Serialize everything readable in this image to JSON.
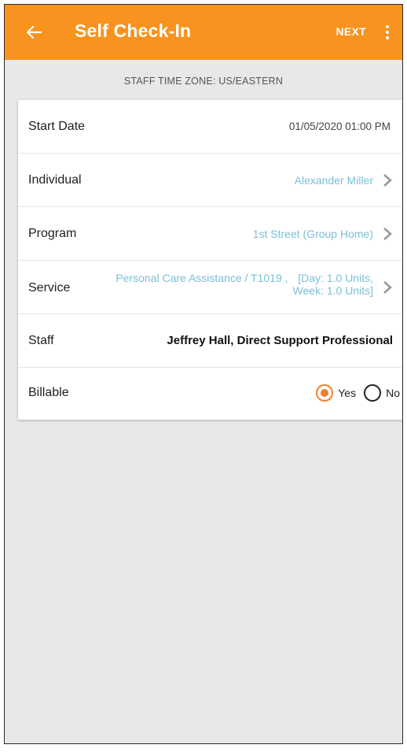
{
  "appbar": {
    "title": "Self Check-In",
    "next_label": "NEXT",
    "back_icon": "arrow-back-icon",
    "more_icon": "more-vert-icon",
    "color": "#f7931e"
  },
  "timezone_text": "STAFF TIME ZONE: US/EASTERN",
  "form": {
    "start_date": {
      "label": "Start Date",
      "value": "01/05/2020 01:00 PM"
    },
    "individual": {
      "label": "Individual",
      "value": "Alexander Miller"
    },
    "program": {
      "label": "Program",
      "value": "1st Street (Group Home)"
    },
    "service": {
      "label": "Service",
      "name": "Personal Care Assistance / T1019 ,",
      "units_line1": "[Day: 1.0 Units,",
      "units_line2": "Week: 1.0 Units]"
    },
    "staff": {
      "label": "Staff",
      "value": "Jeffrey Hall, Direct Support Professional"
    },
    "billable": {
      "label": "Billable",
      "yes_label": "Yes",
      "no_label": "No",
      "selected": "Yes"
    }
  },
  "colors": {
    "accent": "#f07f2a",
    "link_value": "#7bbfd6",
    "background": "#e8e8e8"
  }
}
